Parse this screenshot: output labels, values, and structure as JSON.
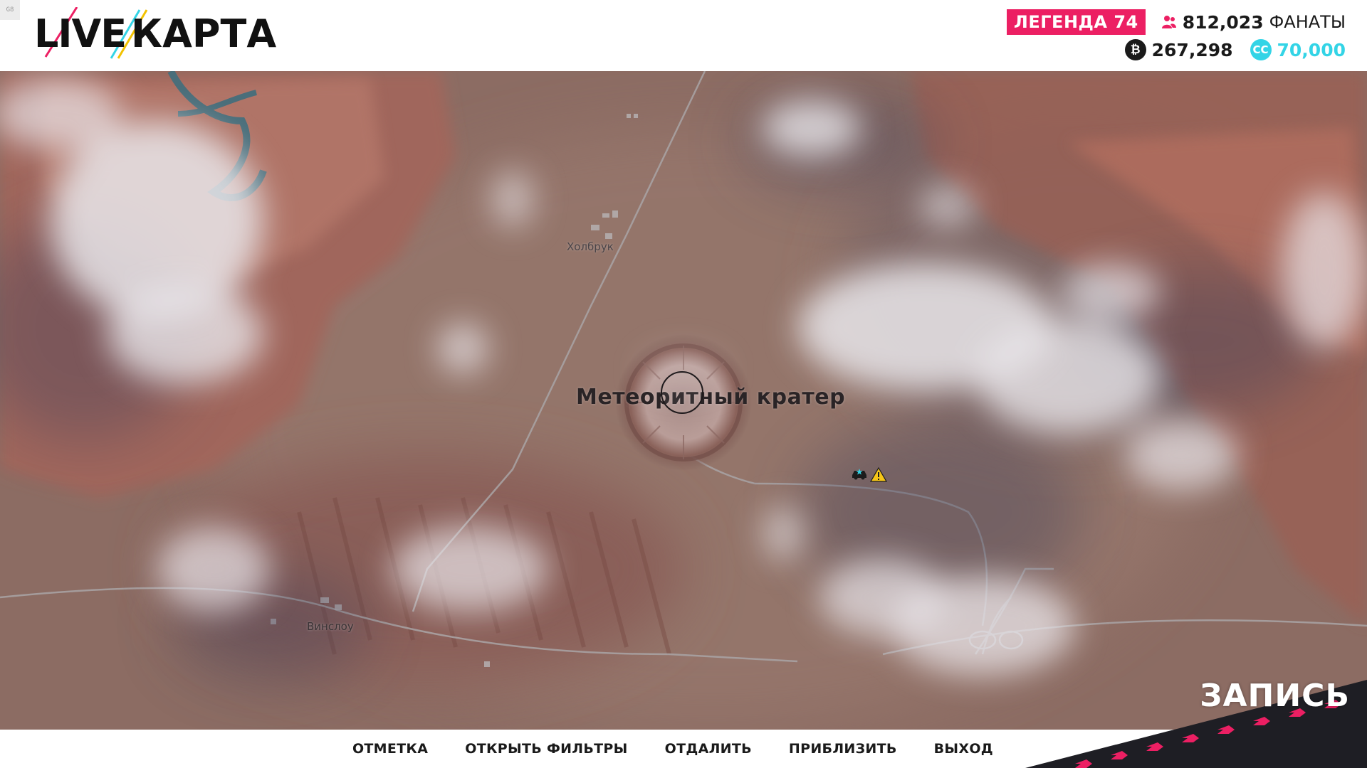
{
  "fps_counter": "G8",
  "logo": {
    "part1": "LIVE",
    "part2": "КАРТА"
  },
  "player_stats": {
    "rank_badge": "ЛЕГЕНДА 74",
    "fans_value": "812,023",
    "fans_label": "ФАНАТЫ",
    "credits_value": "267,298",
    "cc_value": "70,000"
  },
  "map": {
    "locations": {
      "holbrook": "Холбрук",
      "crater": "Метеоритный кратер",
      "winslow": "Винслоу"
    }
  },
  "actions": {
    "mark": "ОТМЕТКА",
    "open_filters": "ОТКРЫТЬ ФИЛЬТРЫ",
    "zoom_out": "ОТДАЛИТЬ",
    "zoom_in": "ПРИБЛИЗИТЬ",
    "exit": "ВЫХОД"
  },
  "recording_label": "ЗАПИСЬ",
  "colors": {
    "accent_pink": "#ec1f63",
    "cc_cyan": "#33d4e6",
    "header_bg": "#ffffff"
  },
  "icons": {
    "fans": "people-icon",
    "credits": "credits-coin-icon",
    "cc": "cc-coin-icon",
    "car": "car-marker-icon",
    "warning": "warning-icon"
  }
}
